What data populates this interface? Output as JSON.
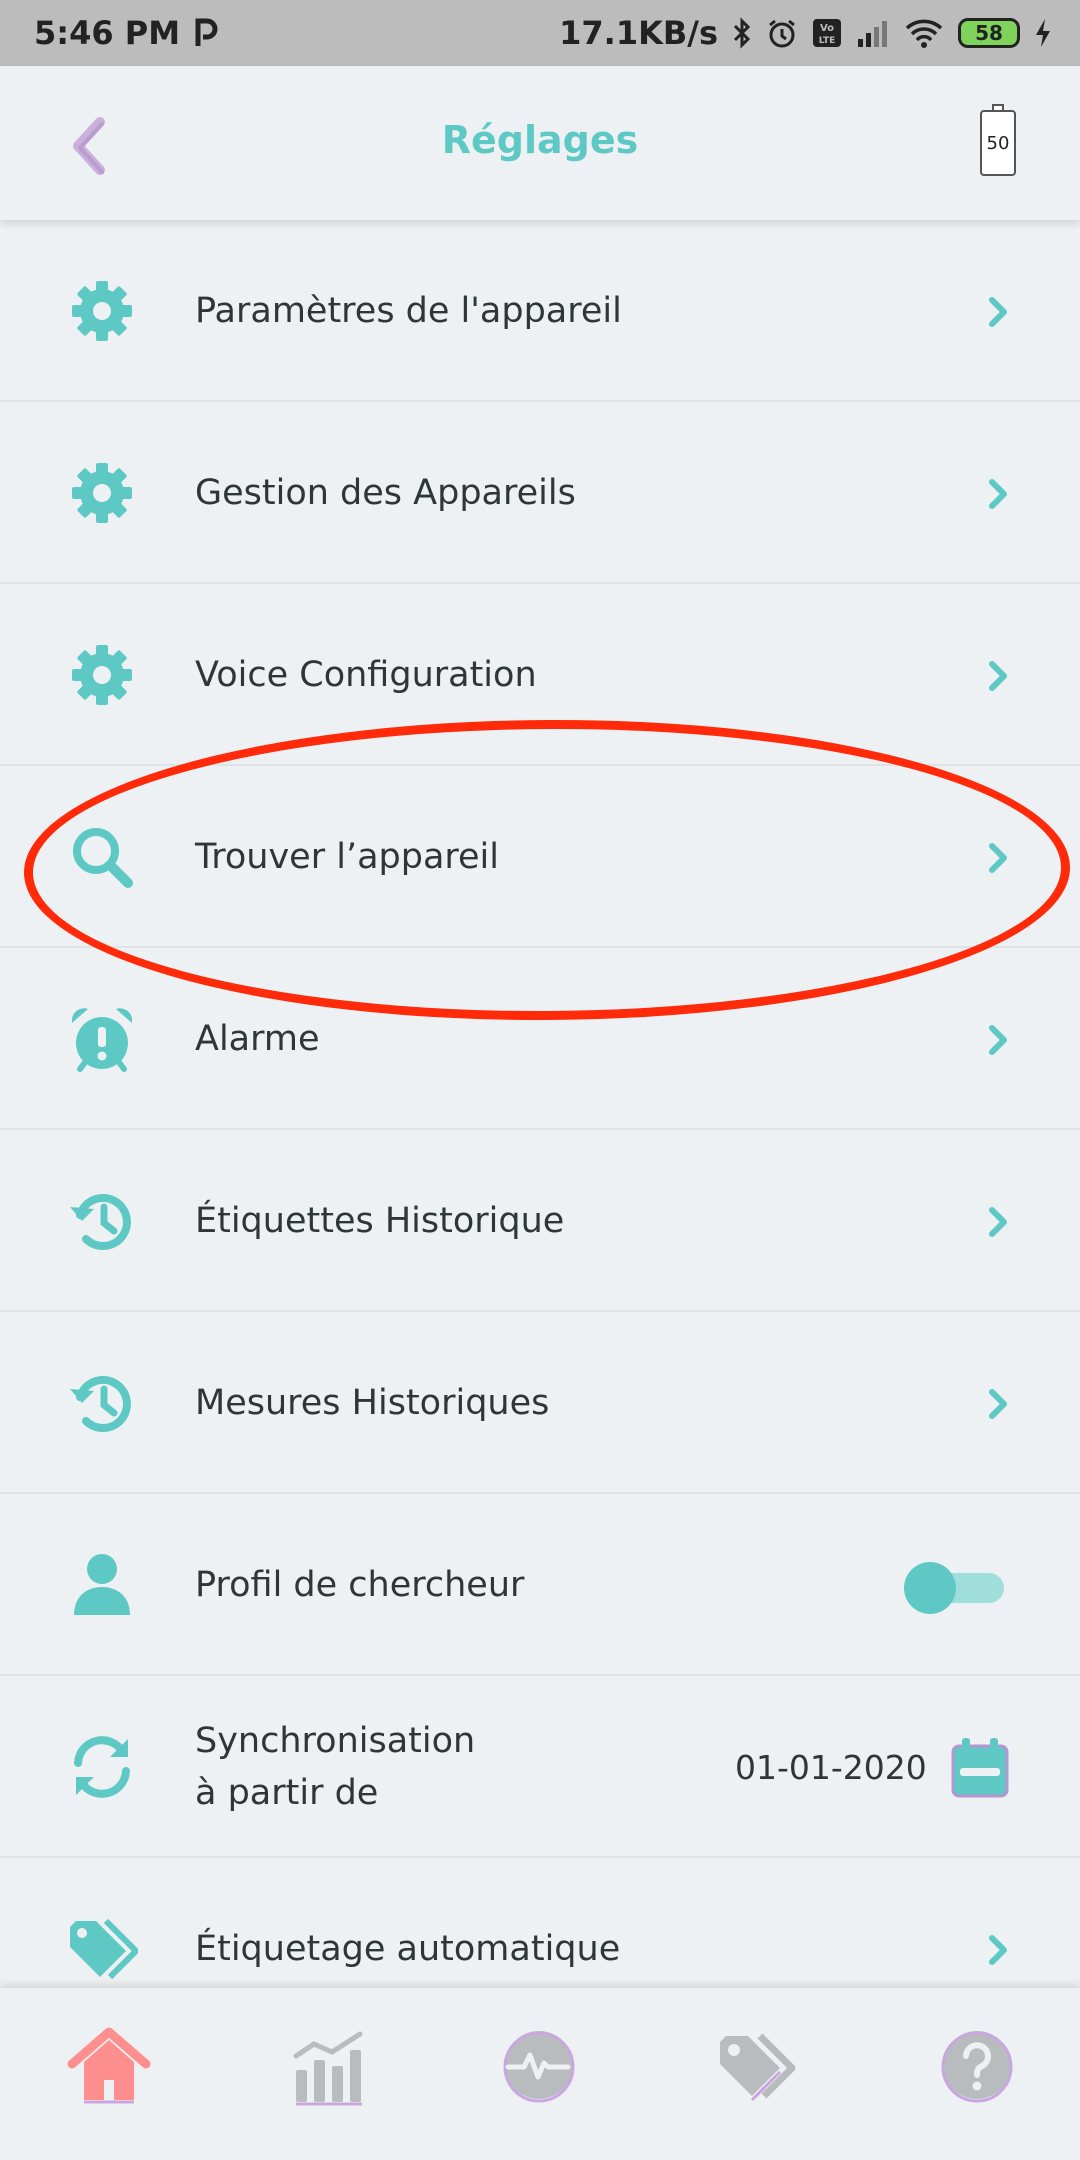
{
  "status_bar": {
    "time": "5:46 PM",
    "network_speed": "17.1KB/s",
    "battery_level": "58"
  },
  "header": {
    "title": "Réglages",
    "device_battery": "50"
  },
  "settings": {
    "items": [
      {
        "label": "Paramètres de l'appareil",
        "icon": "gear-icon"
      },
      {
        "label": "Gestion des Appareils",
        "icon": "gear-icon"
      },
      {
        "label": "Voice Configuration",
        "icon": "gear-icon"
      },
      {
        "label": "Trouver l’appareil",
        "icon": "search-icon"
      },
      {
        "label": "Alarme",
        "icon": "alarm-clock-icon"
      },
      {
        "label": "Étiquettes Historique",
        "icon": "history-icon"
      },
      {
        "label": "Mesures Historiques",
        "icon": "history-icon"
      },
      {
        "label": "Profil de chercheur",
        "icon": "user-icon",
        "toggle_on": true
      },
      {
        "label": "Synchronisation\nà partir de",
        "icon": "sync-icon",
        "value": "01-01-2020"
      },
      {
        "label": "Étiquetage automatique",
        "icon": "tag-icon"
      }
    ]
  },
  "bottom_nav": {
    "items": [
      "home-icon",
      "stats-chart-icon",
      "heartbeat-icon",
      "tags-icon",
      "help-icon"
    ],
    "active": "home-icon"
  },
  "colors": {
    "accent": "#5ec9c4",
    "title": "#5ec9c4",
    "highlight_ring": "#ff2a0a",
    "nav_active": "#ff8f8f",
    "nav_inactive": "#b9bcbf"
  }
}
